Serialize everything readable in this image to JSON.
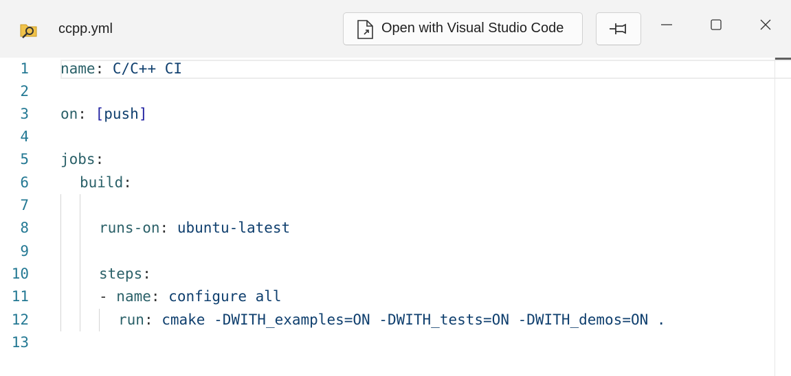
{
  "window": {
    "title": "ccpp.yml",
    "open_with_label": "Open with Visual Studio Code",
    "icons": {
      "app": "folder-search-icon",
      "open_with": "document-arrow-icon",
      "pin": "pin-icon",
      "minimize": "minimize-icon",
      "maximize": "maximize-icon",
      "close": "close-icon"
    }
  },
  "colors": {
    "line_number": "#237893",
    "key": "#2a6068",
    "value": "#0f3f6e",
    "bracket": "#1f1fa0",
    "titlebar_bg": "#f3f3f3"
  },
  "editor": {
    "line_numbers": [
      "1",
      "2",
      "3",
      "4",
      "5",
      "6",
      "7",
      "8",
      "9",
      "10",
      "11",
      "12",
      "13"
    ],
    "lines": [
      {
        "key": "name",
        "sep": ": ",
        "value": "C/C++ CI"
      },
      {},
      {
        "key": "on",
        "sep": ": ",
        "open": "[",
        "value": "push",
        "close": "]"
      },
      {},
      {
        "key": "jobs",
        "sep": ":"
      },
      {
        "key": "build",
        "sep": ":"
      },
      {},
      {
        "key": "runs-on",
        "sep": ": ",
        "value": "ubuntu-latest"
      },
      {},
      {
        "key": "steps",
        "sep": ":"
      },
      {
        "dash": "- ",
        "key": "name",
        "sep": ": ",
        "value": "configure all"
      },
      {
        "key": "run",
        "sep": ": ",
        "value": "cmake -DWITH_examples=ON -DWITH_tests=ON -DWITH_demos=ON ."
      },
      {}
    ]
  }
}
